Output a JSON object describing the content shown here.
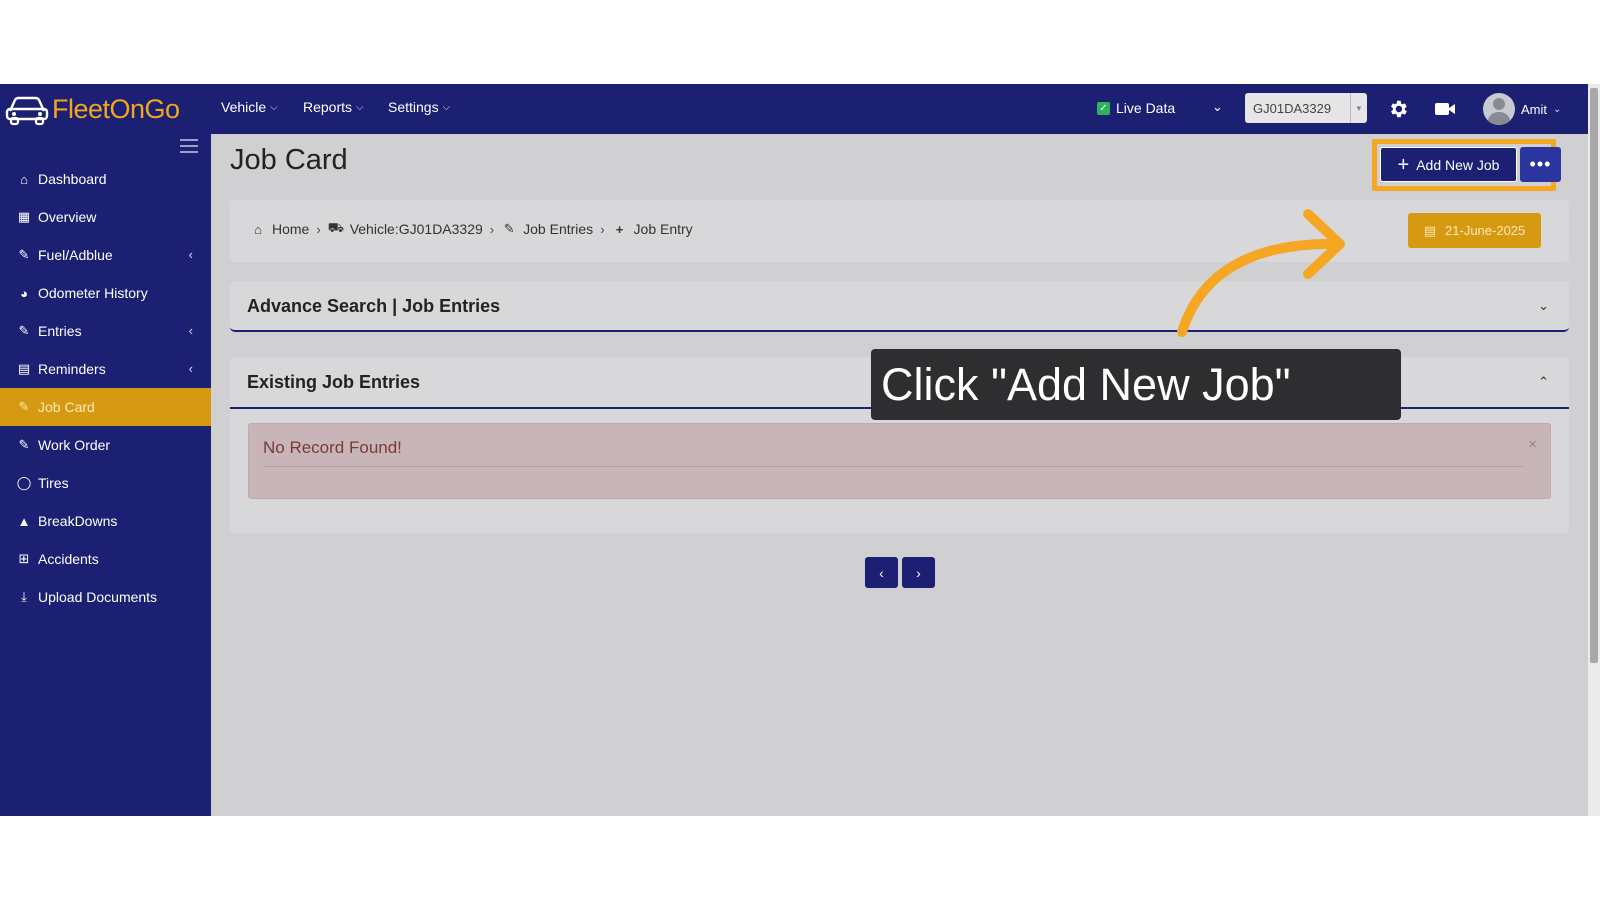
{
  "app": {
    "logo_text": "FleetOnGo",
    "brand_color": "#1b2073",
    "accent_color": "#d69a12"
  },
  "topbar": {
    "menus": [
      {
        "label": "Vehicle"
      },
      {
        "label": "Reports"
      },
      {
        "label": "Settings"
      }
    ],
    "live_data_label": "Live Data",
    "live_data_checked": true,
    "vehicle_select_value": "GJ01DA3329",
    "icons": [
      "gear-icon",
      "video-camera-icon"
    ],
    "user_name": "Amit"
  },
  "sidebar": {
    "items": [
      {
        "label": "Dashboard",
        "icon": "home-icon",
        "has_submenu": false,
        "active": false
      },
      {
        "label": "Overview",
        "icon": "overview-icon",
        "has_submenu": false,
        "active": false
      },
      {
        "label": "Fuel/Adblue",
        "icon": "edit-icon",
        "has_submenu": true,
        "active": false
      },
      {
        "label": "Odometer History",
        "icon": "dashboard-gauge-icon",
        "has_submenu": false,
        "active": false
      },
      {
        "label": "Entries",
        "icon": "edit-icon",
        "has_submenu": true,
        "active": false
      },
      {
        "label": "Reminders",
        "icon": "calendar-icon",
        "has_submenu": true,
        "active": false
      },
      {
        "label": "Job Card",
        "icon": "edit-icon",
        "has_submenu": false,
        "active": true
      },
      {
        "label": "Work Order",
        "icon": "edit-icon",
        "has_submenu": false,
        "active": false
      },
      {
        "label": "Tires",
        "icon": "circle-icon",
        "has_submenu": false,
        "active": false
      },
      {
        "label": "BreakDowns",
        "icon": "warning-icon",
        "has_submenu": false,
        "active": false
      },
      {
        "label": "Accidents",
        "icon": "plus-square-icon",
        "has_submenu": false,
        "active": false
      },
      {
        "label": "Upload Documents",
        "icon": "download-icon",
        "has_submenu": false,
        "active": false
      }
    ]
  },
  "page": {
    "title": "Job Card",
    "add_button_label": "Add New Job",
    "more_button_label": "•••",
    "breadcrumb": [
      {
        "label": "Home",
        "icon": "home-icon"
      },
      {
        "label": "Vehicle:GJ01DA3329",
        "icon": "truck-icon"
      },
      {
        "label": "Job Entries",
        "icon": "edit-icon"
      },
      {
        "label": "Job Entry",
        "icon": "plus-icon"
      }
    ],
    "date_label": "21-June-2025",
    "advance_search_title": "Advance Search | Job Entries",
    "existing_title": "Existing Job Entries",
    "no_record_text": "No Record Found!",
    "pager_prev": "‹",
    "pager_next": "›"
  },
  "annotation": {
    "text": "Click \"Add New Job\"",
    "highlight_color": "#f5a623"
  }
}
